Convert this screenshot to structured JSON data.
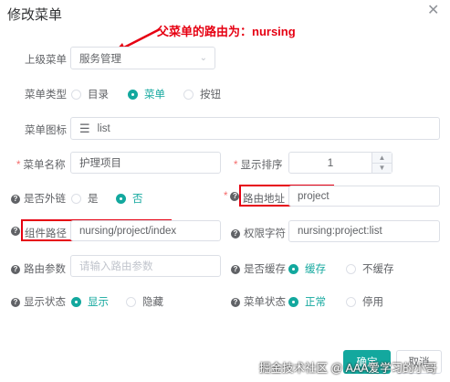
{
  "dialog": {
    "title": "修改菜单",
    "close_icon": "close-icon"
  },
  "annotation": {
    "text": "父菜单的路由为：nursing",
    "color": "#e60012"
  },
  "form": {
    "parent_menu": {
      "label": "上级菜单",
      "value": "服务管理"
    },
    "menu_type": {
      "label": "菜单类型",
      "options": [
        "目录",
        "菜单",
        "按钮"
      ],
      "selected": "菜单"
    },
    "menu_icon": {
      "label": "菜单图标",
      "value": "list",
      "icon": "list-icon"
    },
    "menu_name": {
      "label": "菜单名称",
      "value": "护理项目"
    },
    "sort_order": {
      "label": "显示排序",
      "value": "1"
    },
    "external_link": {
      "label": "是否外链",
      "options": [
        "是",
        "否"
      ],
      "selected": "否"
    },
    "route_path": {
      "label": "路由地址",
      "value": "project"
    },
    "component_path": {
      "label": "组件路径",
      "value": "nursing/project/index"
    },
    "permission": {
      "label": "权限字符",
      "value": "nursing:project:list"
    },
    "route_params": {
      "label": "路由参数",
      "placeholder": "请输入路由参数"
    },
    "cache": {
      "label": "是否缓存",
      "options": [
        "缓存",
        "不缓存"
      ],
      "selected": "缓存"
    },
    "visible": {
      "label": "显示状态",
      "options": [
        "显示",
        "隐藏"
      ],
      "selected": "显示"
    },
    "status": {
      "label": "菜单状态",
      "options": [
        "正常",
        "停用"
      ],
      "selected": "正常"
    }
  },
  "footer": {
    "confirm_label": "确定",
    "cancel_label": "取消"
  },
  "watermark": "掘金技术社区 @ AAA爱学习的小哥",
  "colors": {
    "accent": "#13a89e",
    "required": "#f56c6c",
    "highlight": "#e60012"
  }
}
